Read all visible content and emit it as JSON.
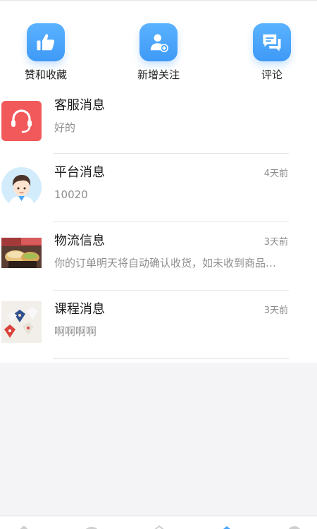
{
  "quick_actions": [
    {
      "label": "赞和收藏",
      "icon": "thumbs-up-icon"
    },
    {
      "label": "新增关注",
      "icon": "add-user-icon"
    },
    {
      "label": "评论",
      "icon": "comment-icon"
    }
  ],
  "messages": [
    {
      "title": "客服消息",
      "time": "",
      "preview": "好的",
      "icon": "customer-service-icon"
    },
    {
      "title": "平台消息",
      "time": "4天前",
      "preview": "10020",
      "icon": "avatar-boy"
    },
    {
      "title": "物流信息",
      "time": "3天前",
      "preview": "你的订单明天将自动确认收货，如未收到商品请及时联系",
      "icon": "food-photo"
    },
    {
      "title": "课程消息",
      "time": "3天前",
      "preview": "啊啊啊啊",
      "icon": "craft-photo"
    }
  ],
  "colors": {
    "accent_blue": "#4aa6fb",
    "service_red": "#f2595a",
    "page_background": "#f4f4f6"
  },
  "bottom_nav_icons": [
    "home-icon",
    "cloud-icon",
    "shop-icon",
    "message-icon",
    "profile-icon"
  ]
}
